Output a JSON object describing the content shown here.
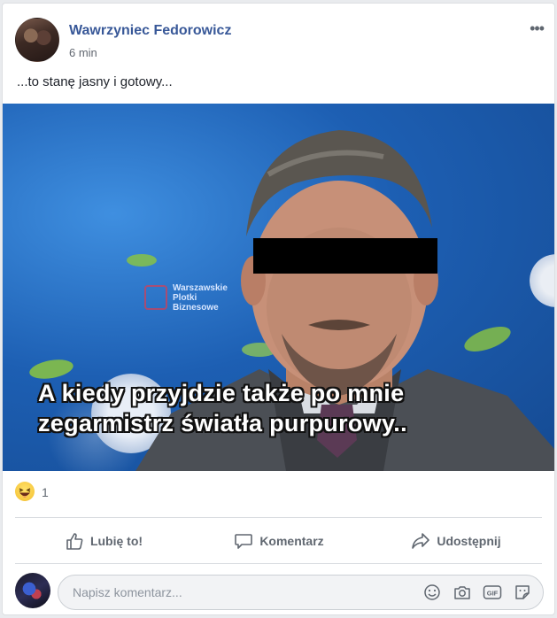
{
  "post": {
    "author": "Wawrzyniec Fedorowicz",
    "time": "6 min",
    "more_label": "•••",
    "text": "...to stanę jasny i gotowy...",
    "image": {
      "watermark": [
        "Warszawskie",
        "Plotki",
        "Biznesowe"
      ],
      "caption": "A kiedy przyjdzie także po mnie\nzegarmistrz światła purpurowy.."
    },
    "reactions": {
      "icon": "haha-emoji-icon",
      "count": "1"
    },
    "actions": {
      "like": "Lubię to!",
      "comment": "Komentarz",
      "share": "Udostępnij"
    },
    "comment": {
      "placeholder": "Napisz komentarz..."
    }
  },
  "colors": {
    "author": "#385898",
    "muted": "#606770",
    "background": "#e9ebee"
  }
}
